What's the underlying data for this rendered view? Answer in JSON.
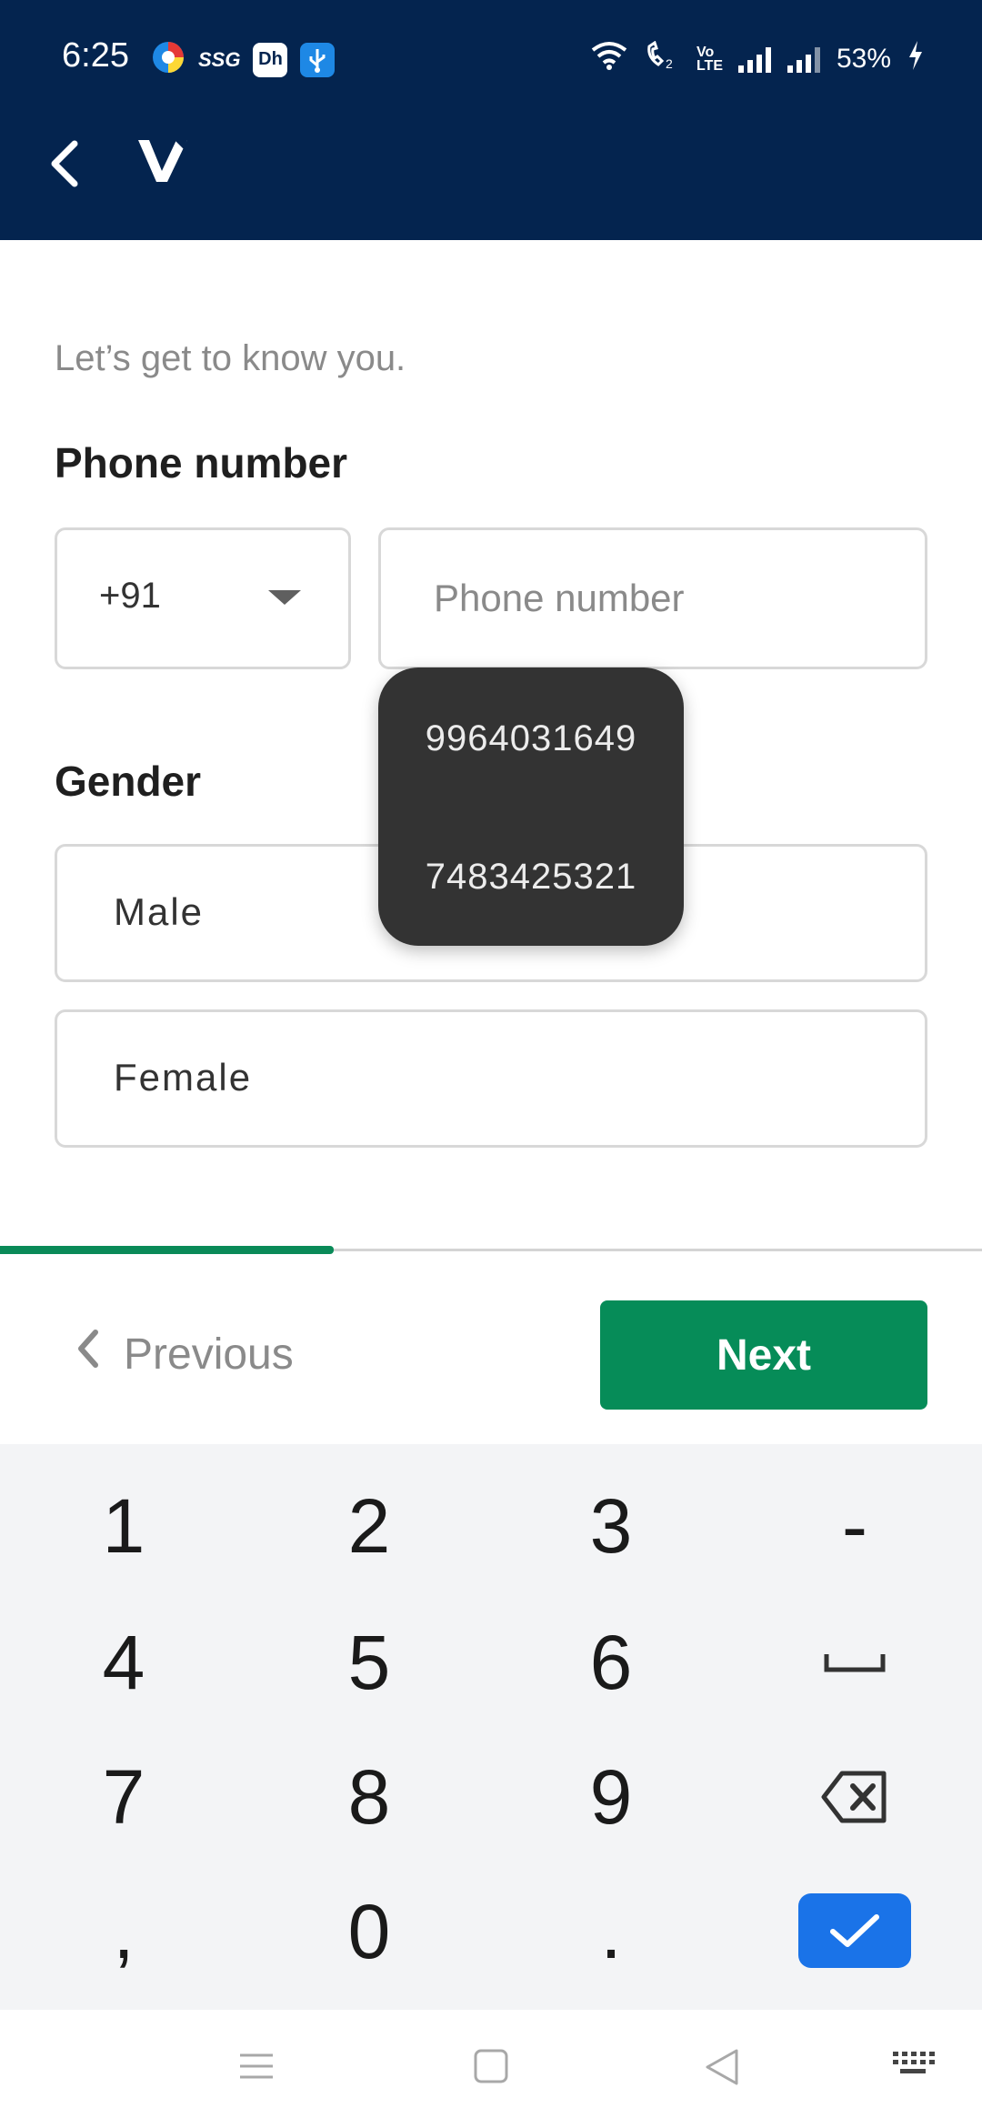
{
  "status_bar": {
    "time": "6:25",
    "left_icons": [
      "browser-icon",
      "ssg-icon",
      "dh-app-icon",
      "usb-icon"
    ],
    "ssg_text": "SSG",
    "dh_text": "Dh",
    "volte_text": "Vo LTE",
    "battery_percent": "53%"
  },
  "app_bar": {
    "back_icon": "chevron-left-icon",
    "logo": "brand-logo"
  },
  "form": {
    "subtitle": "Let’s get to know you.",
    "phone_label": "Phone number",
    "country_code": "+91",
    "phone_placeholder": "Phone number",
    "phone_value": "",
    "gender_label": "Gender",
    "gender_options": [
      "Male",
      "Female"
    ]
  },
  "autofill_suggestions": [
    "9964031649",
    "7483425321"
  ],
  "progress": {
    "fraction": 0.34,
    "color": "#0a8a58"
  },
  "footer": {
    "previous_label": "Previous",
    "next_label": "Next",
    "next_color": "#068c58"
  },
  "keyboard": {
    "rows": [
      [
        "1",
        "2",
        "3",
        "-"
      ],
      [
        "4",
        "5",
        "6",
        "space"
      ],
      [
        "7",
        "8",
        "9",
        "backspace"
      ],
      [
        ",",
        "0",
        ".",
        "done"
      ]
    ],
    "done_color": "#1a73e8"
  },
  "nav_bar": {
    "items": [
      "menu-icon",
      "home-square-icon",
      "back-triangle-icon",
      "keyboard-icon"
    ]
  },
  "colors": {
    "header_bg": "#04244f",
    "text_muted": "#8a8a8a"
  }
}
